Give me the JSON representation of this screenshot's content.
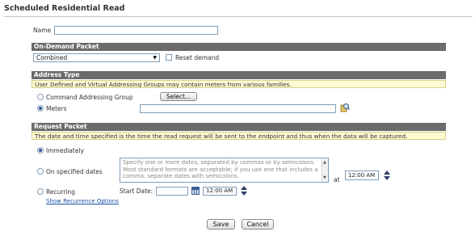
{
  "page": {
    "title": "Scheduled Residential Read"
  },
  "name_field": {
    "label": "Name",
    "value": ""
  },
  "on_demand": {
    "header": "On-Demand Packet",
    "packet_select": "Combined",
    "reset_demand_label": "Reset demand",
    "reset_demand_checked": false
  },
  "address_type": {
    "header": "Address Type",
    "info": "User Defined and Virtual Addressing Groups may contain meters from various families.",
    "command_group_label": "Command Addressing Group",
    "select_button": "Select...",
    "meters_label": "Meters",
    "meters_value": "",
    "selected": "Meters"
  },
  "request_packet": {
    "header": "Request Packet",
    "info": "The date and time specified is the time the read request will be sent to the endpoint and thus when the data will be captured.",
    "immediately_label": "Immediately",
    "on_specified_dates_label": "On specified dates",
    "dates_placeholder": "Specify one or more dates, separated by commas or by semicolons. Most standard formats are acceptable; if you use one that includes a comma, separate dates with semicolons.",
    "at_label": "at",
    "specified_time": "12:00 AM",
    "recurring_label": "Recurring",
    "start_date_label": "Start Date:",
    "start_date_value": "",
    "recurring_time": "12:00 AM",
    "recurrence_link": "Show Recurrence Options",
    "selected": "Immediately"
  },
  "actions": {
    "save": "Save",
    "cancel": "Cancel"
  },
  "colors": {
    "section_header": "#6b6b6b",
    "info_bg": "#fcfad2",
    "link": "#1a4fa3"
  }
}
